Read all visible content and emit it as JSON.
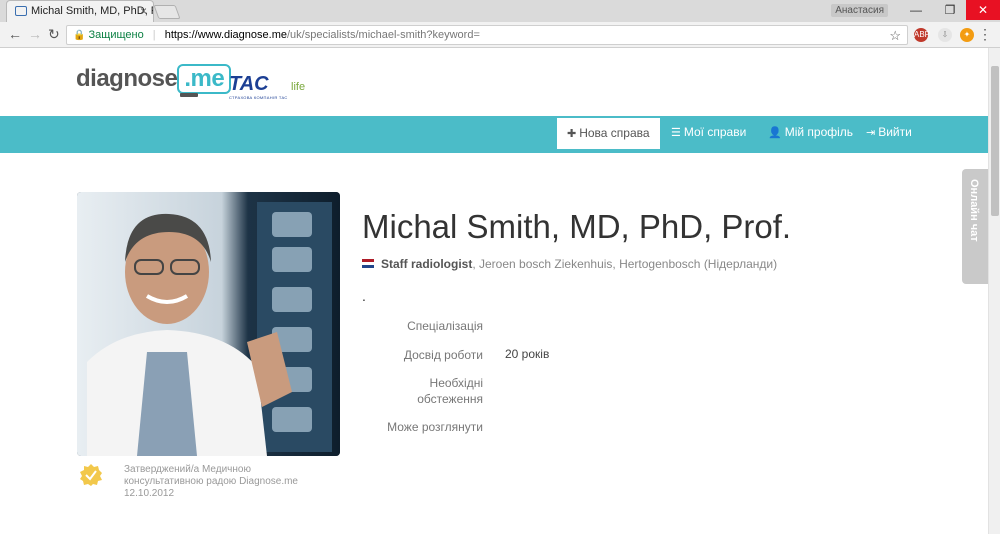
{
  "browser": {
    "tab_title": "Michal Smith, MD, PhD, P",
    "tab_close": "×",
    "user_name": "Анастасия",
    "win_min": "—",
    "win_max": "❐",
    "win_close": "✕",
    "secure_label": "Защищено",
    "url_host": "https://www.diagnose.me",
    "url_path": "/uk/specialists/michael-smith?keyword=",
    "ext1_label": "ABP",
    "ext1_badge": "1"
  },
  "site": {
    "logo_text": "diagnose",
    "logo_me": ".me",
    "partner_logo": "TAC",
    "partner_sub": "life",
    "partner_tagline": "СТРАХОВА КОМПАНІЯ ТАС",
    "accent_color": "#4bbcc8"
  },
  "nav": {
    "new_case": "Нова справа",
    "my_cases": "Мої справи",
    "my_profile": "Мій профіль",
    "logout": "Вийти"
  },
  "doctor": {
    "name": "Michal Smith, MD, PhD, Prof.",
    "position_title": "Staff radiologist",
    "position_rest": ", Jeroen bosch Ziekenhuis, Hertogenbosch (Нідерланди)",
    "dot": ".",
    "specialization_label": "Спеціалізація",
    "experience_label": "Досвід роботи",
    "experience_value": "20 років",
    "exams_label": "Необхідні обстеження",
    "can_review_label": "Може розглянути",
    "approved_text": "Затверджений/а Медичною консультативною радою Diagnose.me",
    "approved_date": "12.10.2012"
  },
  "chat": {
    "label": "Онлайн чат"
  }
}
